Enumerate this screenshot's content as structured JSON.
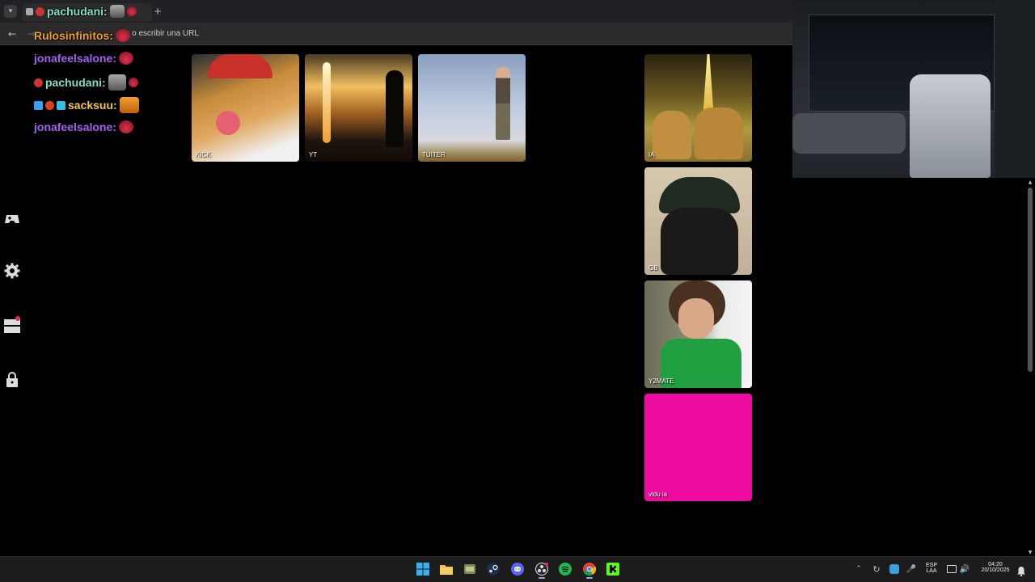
{
  "browser": {
    "tab_title": "pachudani:",
    "new_tab": "+",
    "address_placeholder": "gle o escribir una URL"
  },
  "chat": {
    "messages": [
      {
        "user": "pachudani:",
        "color": "#7fe0c4"
      },
      {
        "user": "Rulosinfinitos:",
        "color": "#f0a020"
      },
      {
        "user": "jonafeelsalone:",
        "color": "#a55ff0"
      },
      {
        "user": "pachudani:",
        "color": "#7fe0c4"
      },
      {
        "user": "sacksuu:",
        "color": "#f5c542"
      },
      {
        "user": "jonafeelsalone:",
        "color": "#a55ff0"
      }
    ]
  },
  "sidebar": {
    "icons": [
      "gamepad-icon",
      "gear-icon",
      "layers-icon",
      "lock-icon"
    ]
  },
  "tiles": [
    {
      "label": "KICK",
      "icon": "dog-image"
    },
    {
      "label": "YT",
      "icon": "silhouette-image"
    },
    {
      "label": "TUITER",
      "icon": "man-sky-image"
    },
    {
      "label": "IA",
      "icon": "eiffel-cats-image"
    },
    {
      "label": "GB",
      "icon": "cat-cap-image"
    },
    {
      "label": "Y2MATE",
      "icon": "curly-man-image"
    },
    {
      "label": "vidu ia",
      "icon": "pink-square",
      "color": "#ee0ca0"
    }
  ],
  "taskbar": {
    "lang_line1": "ESP",
    "lang_line2": "LAA",
    "time": "04:20",
    "date": "20/10/2025"
  }
}
